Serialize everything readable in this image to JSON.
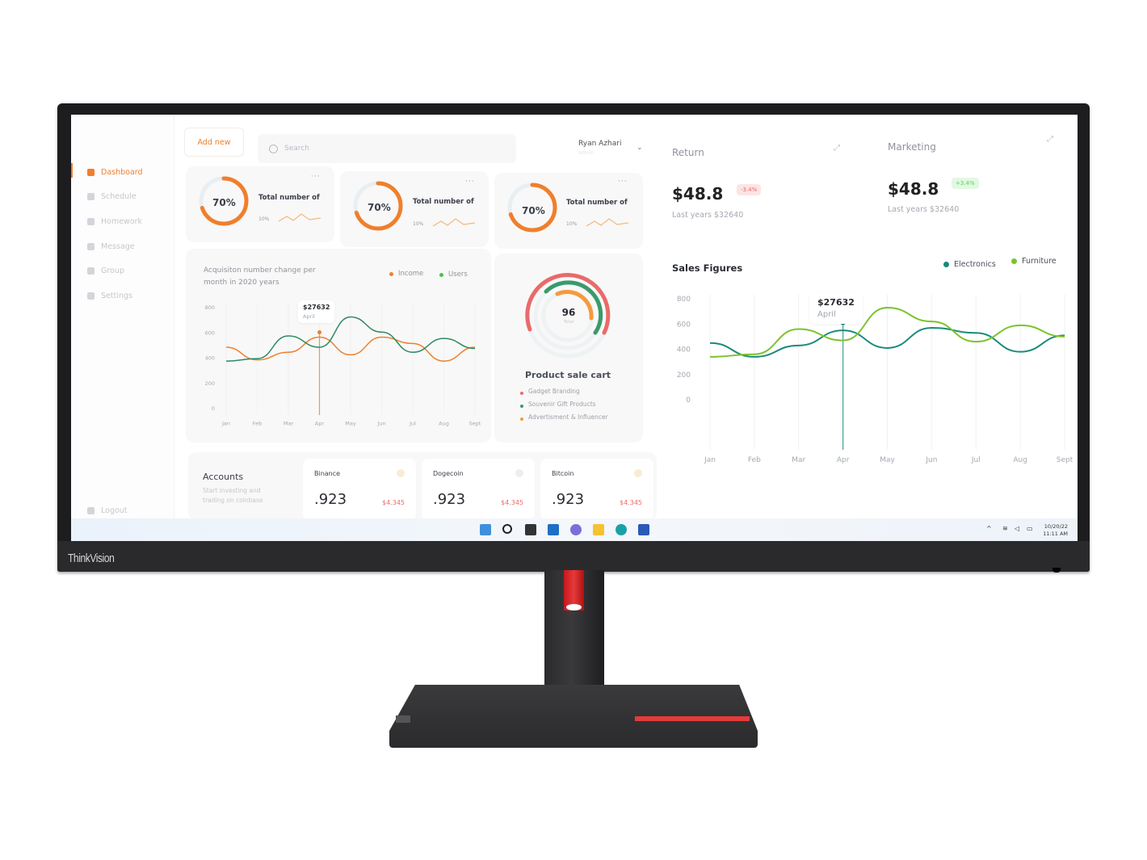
{
  "device": {
    "brand": "ThinkVision"
  },
  "sidebar": {
    "items": [
      {
        "label": "Dashboard",
        "icon": "grid-icon",
        "active": true
      },
      {
        "label": "Schedule",
        "icon": "calendar-icon",
        "active": false
      },
      {
        "label": "Homework",
        "icon": "briefcase-icon",
        "active": false
      },
      {
        "label": "Message",
        "icon": "mail-icon",
        "active": false
      },
      {
        "label": "Group",
        "icon": "users-icon",
        "active": false
      },
      {
        "label": "Settings",
        "icon": "gear-icon",
        "active": false
      }
    ],
    "logout": "Logout"
  },
  "header": {
    "add_new": "Add new",
    "search_placeholder": "Search",
    "user_name": "Ryan Azhari",
    "user_role": "Admin"
  },
  "stats": [
    {
      "percent": "70%",
      "progress": 0.7,
      "title": "Total number of",
      "change": "10%"
    },
    {
      "percent": "70%",
      "progress": 0.7,
      "title": "Total number of",
      "change": "10%"
    },
    {
      "percent": "70%",
      "progress": 0.7,
      "title": "Total number of",
      "change": "10%"
    }
  ],
  "product_cart": {
    "total": "96",
    "total_label": "Total",
    "title": "Product sale cart",
    "items": [
      {
        "label": "Gadget Branding",
        "color": "#ea6a6a"
      },
      {
        "label": "Souvenir Gift Products",
        "color": "#3a9a6a"
      },
      {
        "label": "Advertisment & Influencer",
        "color": "#f59a3c"
      }
    ]
  },
  "accounts": {
    "title": "Accounts",
    "subtitle": "Start investing and trading on coinbase",
    "coins": [
      {
        "name": "Binance",
        "value": ".923",
        "price": "$4.345"
      },
      {
        "name": "Dogecoin",
        "value": ".923",
        "price": "$4.345"
      },
      {
        "name": "Bitcoin",
        "value": ".923",
        "price": "$4.345"
      }
    ]
  },
  "return": {
    "label": "Return",
    "value": "$48.8",
    "badge": "-3.4%",
    "sub": "Last years $32640"
  },
  "marketing": {
    "label": "Marketing",
    "value": "$48.8",
    "badge": "+3.4%",
    "sub": "Last years $32640"
  },
  "taskbar": {
    "date": "10/20/22",
    "time": "11:11 AM"
  },
  "chart_data": [
    {
      "type": "line",
      "title": "Acquisiton number change per month in 2020 years",
      "categories": [
        "Jan",
        "Feb",
        "Mar",
        "Apr",
        "May",
        "Jun",
        "Jul",
        "Aug",
        "Sept"
      ],
      "ylim": [
        0,
        800
      ],
      "yticks": [
        0,
        200,
        400,
        600,
        800
      ],
      "series": [
        {
          "name": "Income",
          "color": "#f07f2c",
          "values": [
            480,
            380,
            440,
            560,
            420,
            560,
            510,
            370,
            480
          ]
        },
        {
          "name": "Users",
          "color": "#2f8a62",
          "values": [
            370,
            390,
            570,
            480,
            720,
            600,
            440,
            550,
            470
          ]
        }
      ],
      "tooltip": {
        "value": "$27632",
        "label": "April",
        "index": 3
      },
      "legend": "top-right"
    },
    {
      "type": "line",
      "title": "Sales Figures",
      "categories": [
        "Jan",
        "Feb",
        "Mar",
        "Apr",
        "May",
        "Jun",
        "Jul",
        "Aug",
        "Sept"
      ],
      "ylim": [
        0,
        800
      ],
      "yticks": [
        0,
        200,
        400,
        600,
        800
      ],
      "series": [
        {
          "name": "Electronics",
          "color": "#1a8a7a",
          "values": [
            450,
            340,
            430,
            550,
            410,
            570,
            530,
            380,
            510
          ]
        },
        {
          "name": "Furniture",
          "color": "#7bc42c",
          "values": [
            340,
            360,
            560,
            470,
            730,
            620,
            460,
            590,
            500
          ]
        }
      ],
      "tooltip": {
        "value": "$27632",
        "label": "April",
        "index": 3
      },
      "legend": "top-right"
    }
  ]
}
